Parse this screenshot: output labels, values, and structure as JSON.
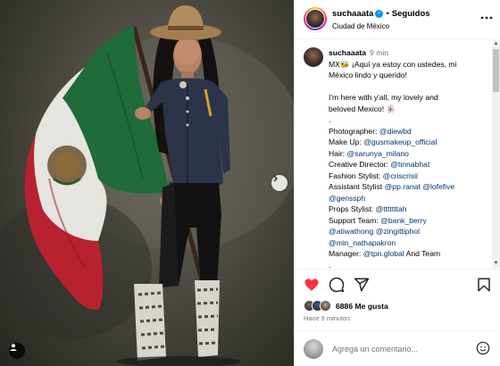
{
  "post": {
    "image_alt": "",
    "tag_icon": "user-tag-icon",
    "next_icon": "chevron-right-icon"
  },
  "header": {
    "username": "suchaaata",
    "verified": true,
    "separator": "•",
    "follow_status": "Seguidos",
    "location": "Ciudad de México",
    "more_icon": "more-horizontal-icon"
  },
  "caption": {
    "username": "suchaaata",
    "time": "9 min",
    "lines": [
      {
        "parts": [
          {
            "t": "MX🐝 ¡Aquí ya estoy con ustedes, mi",
            "m": false
          }
        ]
      },
      {
        "parts": [
          {
            "t": "México lindo y querido!",
            "m": false
          }
        ]
      },
      {
        "gap": true
      },
      {
        "parts": [
          {
            "t": "I'm here with y'all, my lovely and",
            "m": false
          }
        ]
      },
      {
        "parts": [
          {
            "t": "beloved Mexico! 🪅",
            "m": false
          }
        ]
      },
      {
        "parts": [
          {
            "t": ".",
            "m": false
          }
        ]
      },
      {
        "parts": [
          {
            "t": "Photographer: ",
            "m": false
          },
          {
            "t": "@diewbd",
            "m": true
          }
        ]
      },
      {
        "parts": [
          {
            "t": "Make Up: ",
            "m": false
          },
          {
            "t": "@gusmakeup_official",
            "m": true
          }
        ]
      },
      {
        "parts": [
          {
            "t": "Hair: ",
            "m": false
          },
          {
            "t": "@sarunya_milano",
            "m": true
          }
        ]
      },
      {
        "parts": [
          {
            "t": "Creative Director: ",
            "m": false
          },
          {
            "t": "@tinnabhat",
            "m": true
          }
        ]
      },
      {
        "parts": [
          {
            "t": "Fashion Stylist: ",
            "m": false
          },
          {
            "t": "@criscrisii",
            "m": true
          }
        ]
      },
      {
        "parts": [
          {
            "t": "Assistant Stylist ",
            "m": false
          },
          {
            "t": "@pp.ranat",
            "m": true
          },
          {
            "t": " ",
            "m": false
          },
          {
            "t": "@lofefive",
            "m": true
          }
        ]
      },
      {
        "parts": [
          {
            "t": "@genssph",
            "m": true
          }
        ]
      },
      {
        "parts": [
          {
            "t": "Props Stylist: ",
            "m": false
          },
          {
            "t": "@tttttttah",
            "m": true
          }
        ]
      },
      {
        "parts": [
          {
            "t": "Support Team: ",
            "m": false
          },
          {
            "t": "@bank_berry",
            "m": true
          }
        ]
      },
      {
        "parts": [
          {
            "t": "@atiwathong",
            "m": true
          },
          {
            "t": " ",
            "m": false
          },
          {
            "t": "@zingittiphol",
            "m": true
          }
        ]
      },
      {
        "parts": [
          {
            "t": "@min_nathapakron",
            "m": true
          }
        ]
      },
      {
        "parts": [
          {
            "t": "Manager: ",
            "m": false
          },
          {
            "t": "@tpn.global",
            "m": true
          },
          {
            "t": " And Team",
            "m": false
          }
        ]
      },
      {
        "parts": [
          {
            "t": ".",
            "m": false
          }
        ]
      }
    ]
  },
  "actions": {
    "like_icon": "heart-filled-icon",
    "comment_icon": "comment-icon",
    "share_icon": "share-icon",
    "save_icon": "bookmark-icon"
  },
  "likes": {
    "count": "6886 Me gusta",
    "face_colors": [
      "#7a6a5a",
      "#3d5a80",
      "#c0a080"
    ]
  },
  "timestamp": "Hace 9 minutos",
  "comment_box": {
    "placeholder": "Agrega un comentario...",
    "emoji_icon": "emoji-smile-icon"
  },
  "colors": {
    "like": "#ff3040",
    "mention": "#00376b",
    "verified": "#0095f6",
    "flag_green": "#1f6b3a",
    "flag_red": "#b82230"
  }
}
